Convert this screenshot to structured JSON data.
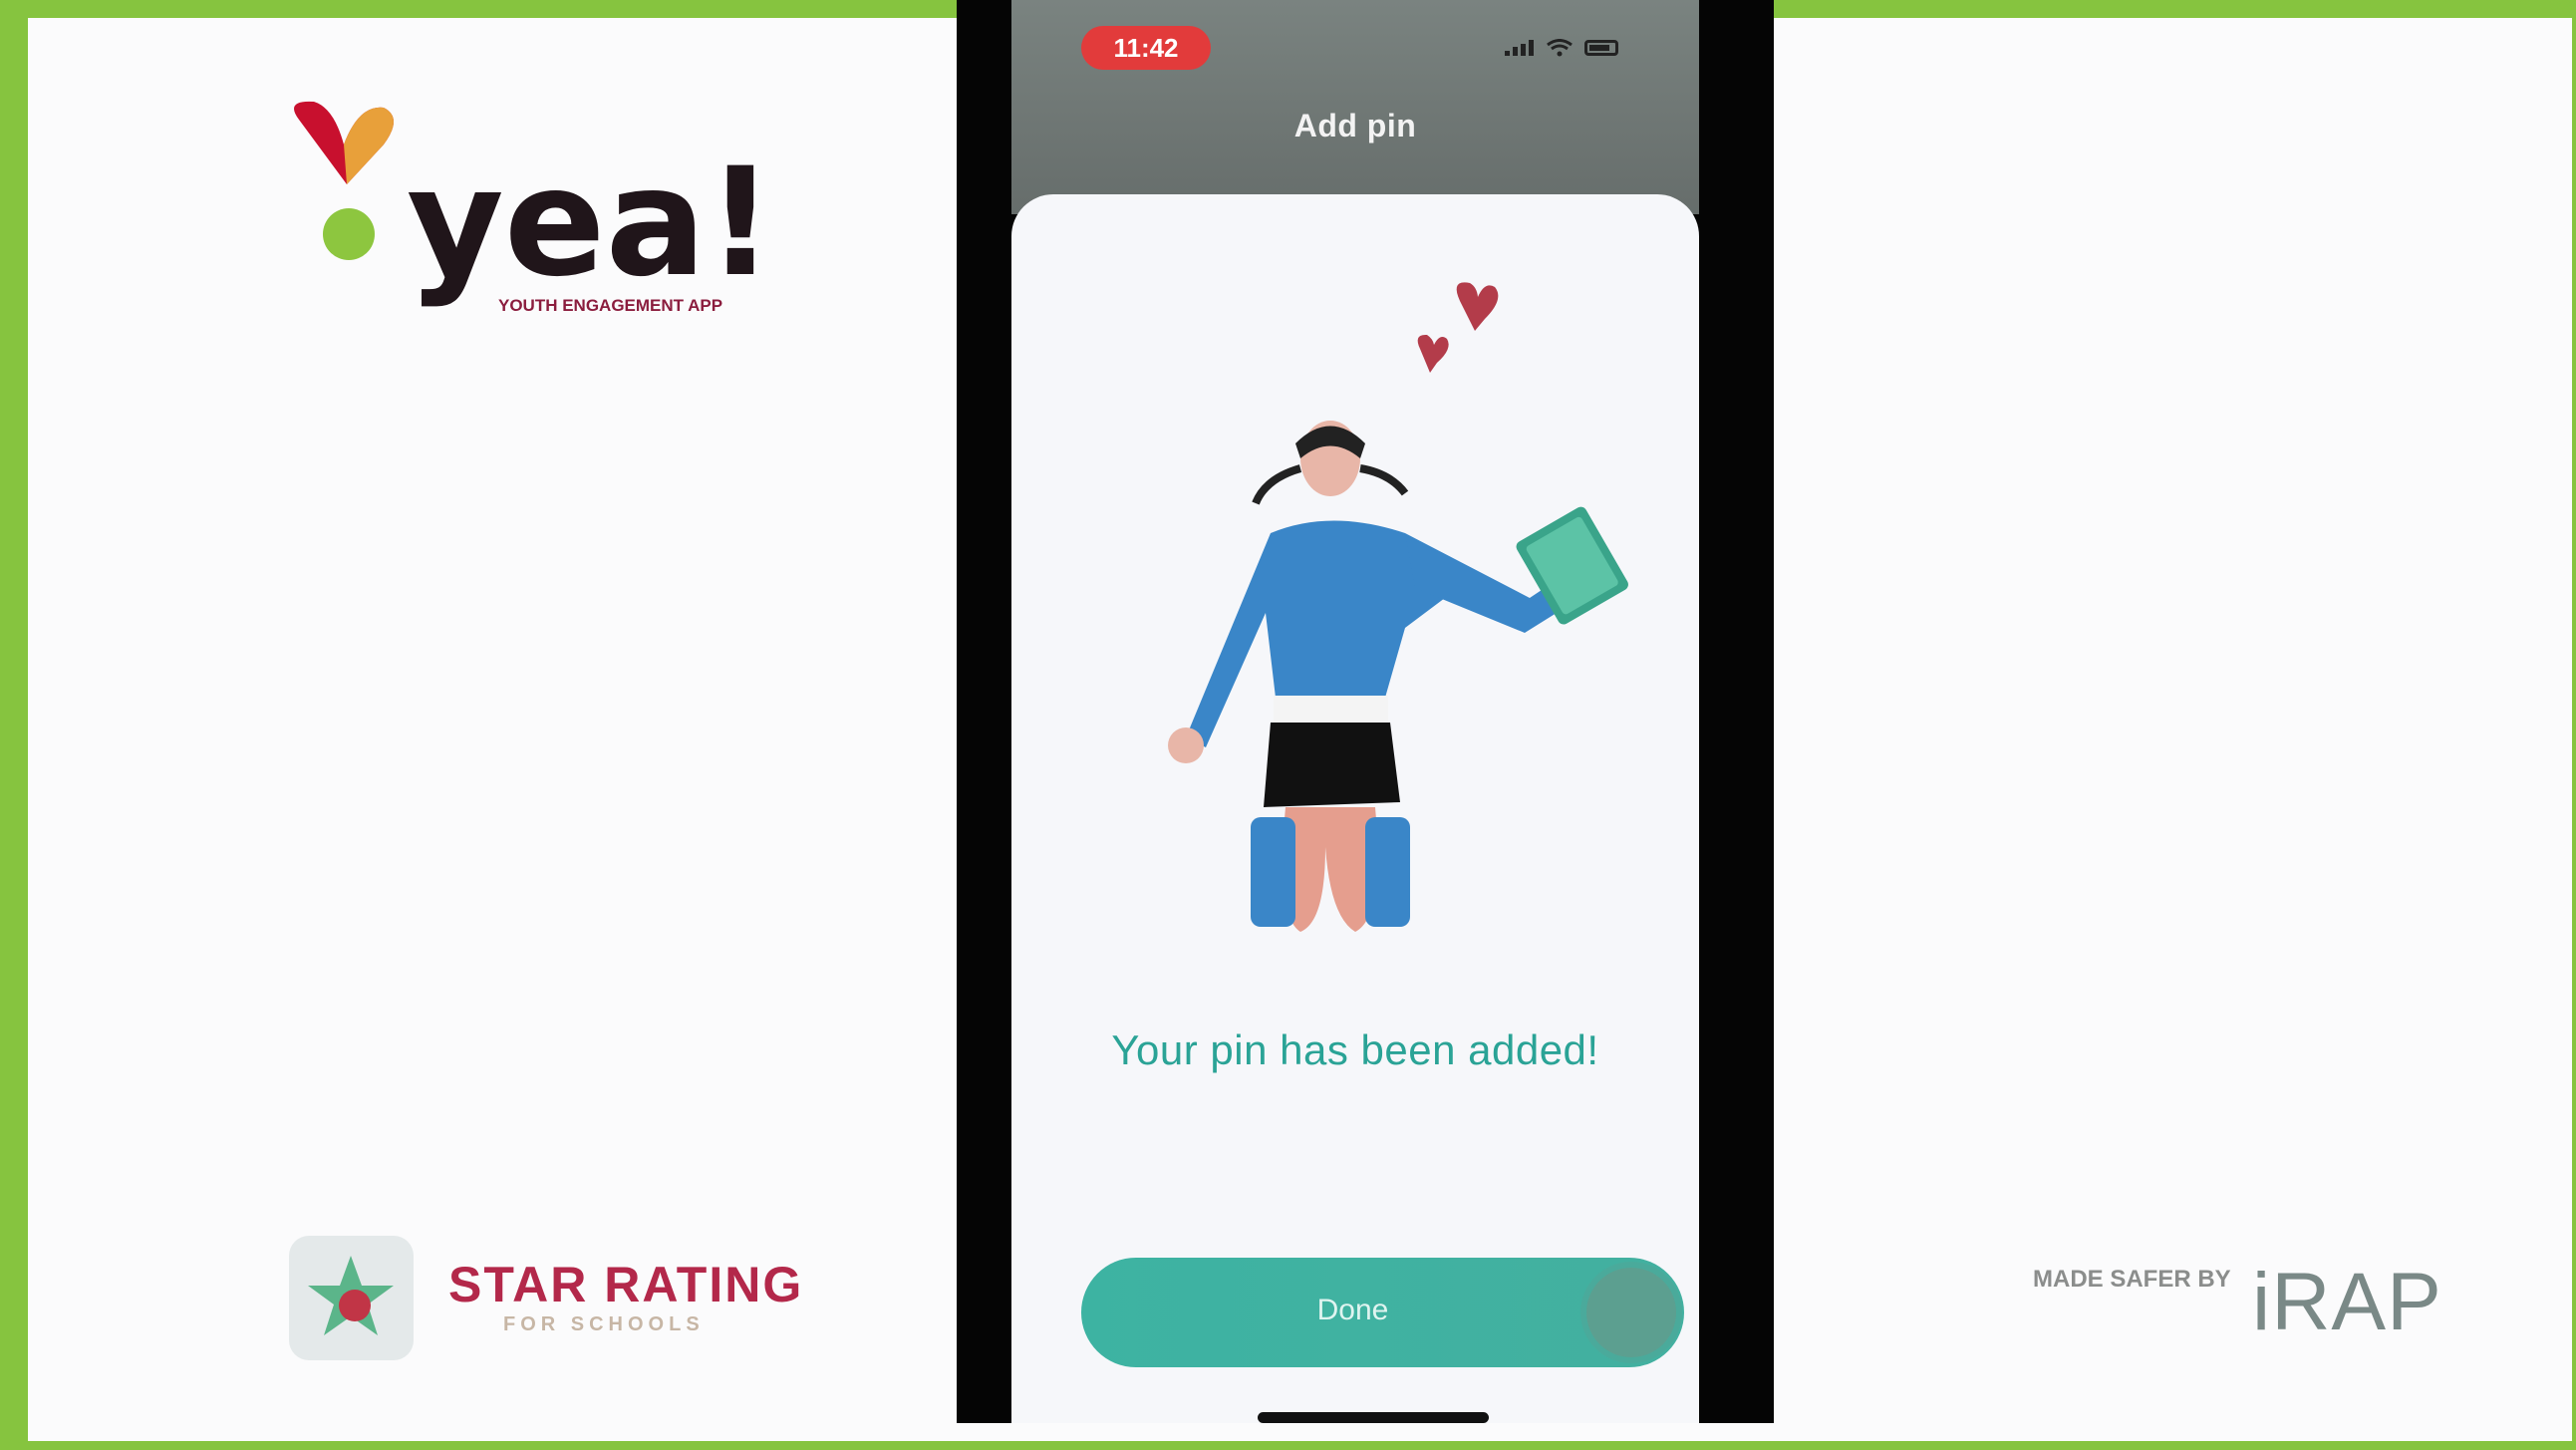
{
  "colors": {
    "frame_border": "#86c43f",
    "teal_accent": "#2aa396",
    "button_teal": "#3db3a2",
    "yea_dark": "#20151a",
    "yea_maroon": "#8b1d3e",
    "star_rating_red": "#b3284a",
    "status_red": "#e23b3b"
  },
  "yea_logo": {
    "wordmark": "yea!",
    "tagline": "YOUTH ENGAGEMENT APP"
  },
  "phone": {
    "status_bar": {
      "time": "11:42",
      "icons": [
        "signal-icon",
        "wifi-icon",
        "battery-icon"
      ]
    },
    "header": {
      "title": "Add pin"
    },
    "illustration": "person-with-book-and-hearts-illustration",
    "message": "Your pin has been added!",
    "done_button": {
      "label": "Done"
    }
  },
  "star_rating": {
    "title": "STAR RATING",
    "subtitle": "FOR SCHOOLS",
    "icon": "star-rating-app-icon"
  },
  "irap": {
    "made_safer_label": "MADE SAFER BY",
    "logo_text": "iRAP"
  }
}
